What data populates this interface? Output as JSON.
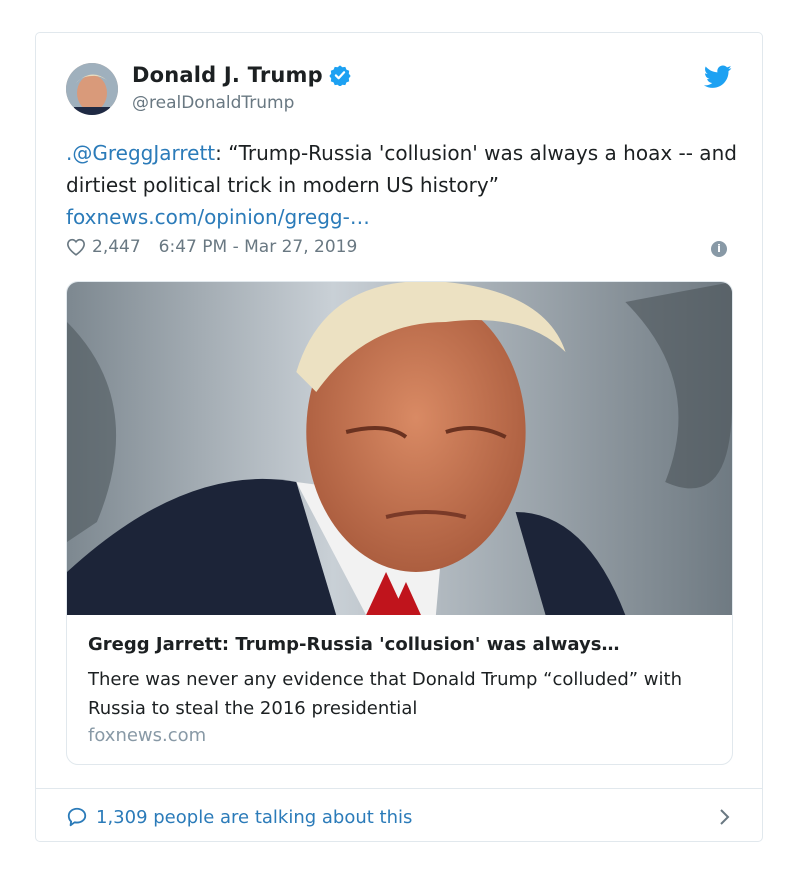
{
  "tweet": {
    "author_name": "Donald J. Trump",
    "handle": "@realDonaldTrump",
    "mention": ".@GreggJarrett",
    "text_body": ": “Trump-Russia 'collusion' was always a hoax -- and dirtiest political trick in modern US history”",
    "link_text": "foxnews.com/opinion/gregg-…",
    "likes": "2,447",
    "timestamp": "6:47 PM - Mar 27, 2019"
  },
  "link_card": {
    "title": "Gregg Jarrett: Trump-Russia 'collusion' was always…",
    "description": "There was never any evidence that Donald Trump “colluded” with Russia to steal the 2016 presidential",
    "domain": "foxnews.com"
  },
  "footer": {
    "talking_text": "1,309 people are talking about this"
  },
  "colors": {
    "link": "#2b7bb9",
    "verified": "#1da1f2",
    "muted": "#697882",
    "border": "#e1e8ed"
  },
  "icons": [
    "verified-badge-icon",
    "twitter-bird-icon",
    "heart-icon",
    "info-icon",
    "comment-bubble-icon",
    "chevron-right-icon"
  ]
}
